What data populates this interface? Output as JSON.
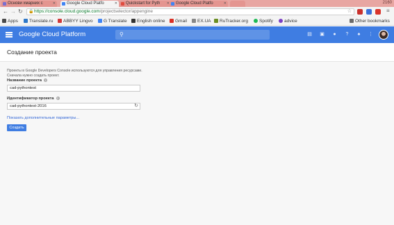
{
  "browser": {
    "tabs": [
      {
        "label": "Основи хмарних с",
        "active": false,
        "favicon_color": "#7a6fd0"
      },
      {
        "label": "Google Cloud Platfo",
        "active": true,
        "favicon_color": "#4285f4"
      },
      {
        "label": "Quickstart for Pyth",
        "active": false,
        "favicon_color": "#e04b3f"
      },
      {
        "label": "Google Cloud Platfo",
        "active": false,
        "favicon_color": "#4285f4"
      }
    ],
    "window_control": "2160",
    "address": {
      "lock": "🔒",
      "scheme": "https://",
      "host": "console.cloud.google.com",
      "path": "/projectselector/appengine"
    },
    "bookmarks": [
      {
        "label": "Apps",
        "color": "#4a4a4a"
      },
      {
        "label": "Translate.ru",
        "color": "#2f78c8"
      },
      {
        "label": "ABBYY Lingvo",
        "color": "#d03a3a"
      },
      {
        "label": "G Translate",
        "color": "#4285f4"
      },
      {
        "label": "English online",
        "color": "#333333"
      },
      {
        "label": "Gmail",
        "color": "#d93025"
      },
      {
        "label": "EX.UA",
        "color": "#888888"
      },
      {
        "label": "RuTracker.org",
        "color": "#6b8e23"
      },
      {
        "label": "Spotify",
        "color": "#1db954"
      },
      {
        "label": "advice",
        "color": "#7b3fc4"
      },
      {
        "label": "Other bookmarks",
        "color": "#6b6b6b"
      }
    ]
  },
  "header": {
    "title": "Google Cloud Platform",
    "accent": "#3f7de2"
  },
  "page": {
    "title": "Создание проекта",
    "description_line1": "Проекты в Google Developers Console используются для управления ресурсами.",
    "description_line2": "Сначала нужно создать проект.",
    "project_name": {
      "label": "Название проекта",
      "value": "cad-pythontest"
    },
    "project_id": {
      "label": "Идентификатор проекта",
      "value": "cad-pythontest-2016"
    },
    "advanced_link": "Показать дополнительные параметры...",
    "create_button": "Создать"
  }
}
